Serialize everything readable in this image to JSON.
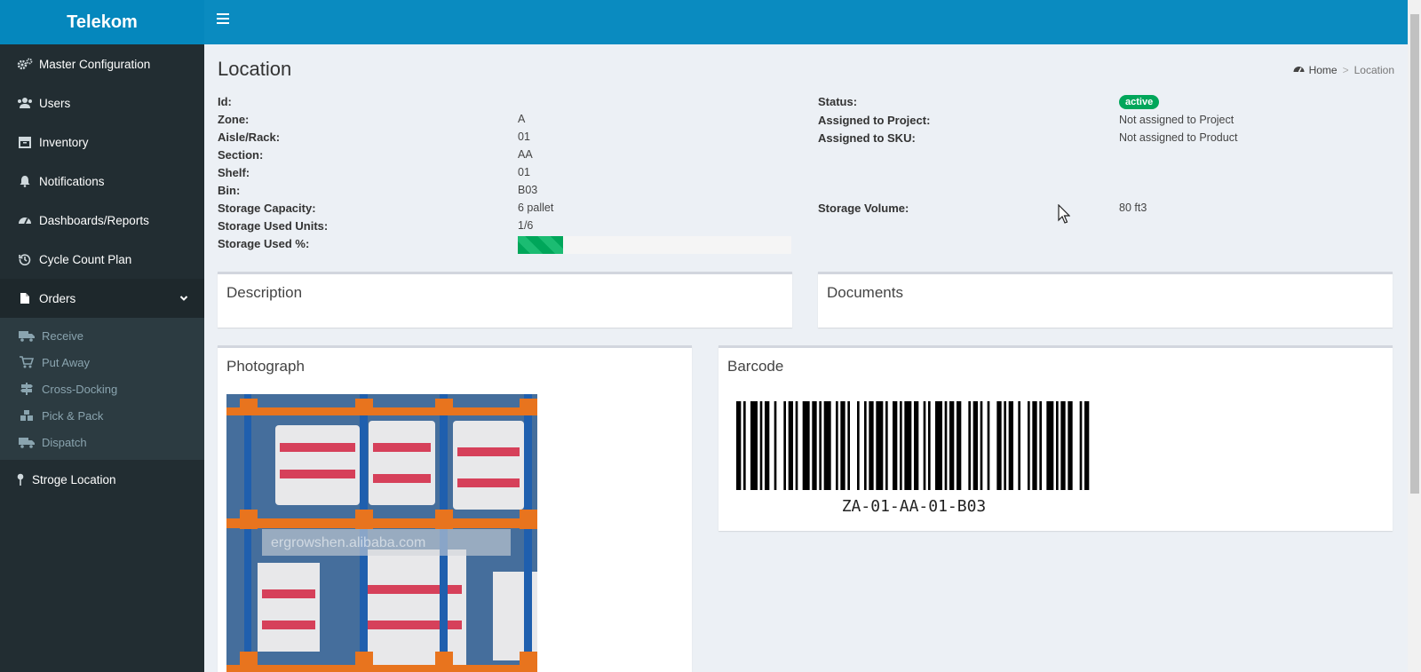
{
  "app": {
    "brand": "Telekom"
  },
  "sidebar": {
    "items": [
      {
        "label": "Master Configuration",
        "icon": "gears-icon"
      },
      {
        "label": "Users",
        "icon": "users-icon"
      },
      {
        "label": "Inventory",
        "icon": "inventory-icon"
      },
      {
        "label": "Notifications",
        "icon": "bell-icon"
      },
      {
        "label": "Dashboards/Reports",
        "icon": "dashboard-icon"
      },
      {
        "label": "Cycle Count Plan",
        "icon": "history-icon"
      },
      {
        "label": "Orders",
        "icon": "file-icon",
        "expanded": true
      },
      {
        "label": "Stroge Location",
        "icon": "map-pin-icon"
      }
    ],
    "orders_submenu": [
      {
        "label": "Receive",
        "icon": "truck-icon"
      },
      {
        "label": "Put Away",
        "icon": "cart-icon"
      },
      {
        "label": "Cross-Docking",
        "icon": "signs-icon"
      },
      {
        "label": "Pick & Pack",
        "icon": "cubes-icon"
      },
      {
        "label": "Dispatch",
        "icon": "truck-icon"
      }
    ]
  },
  "page": {
    "title": "Location",
    "breadcrumb": {
      "home": "Home",
      "current": "Location"
    }
  },
  "details": {
    "id_label": "Id:",
    "id_value": "",
    "zone_label": "Zone:",
    "zone_value": "A",
    "aisle_label": "Aisle/Rack:",
    "aisle_value": "01",
    "section_label": "Section:",
    "section_value": "AA",
    "shelf_label": "Shelf:",
    "shelf_value": "01",
    "bin_label": "Bin:",
    "bin_value": "B03",
    "capacity_label": "Storage Capacity:",
    "capacity_value": "6 pallet",
    "used_units_label": "Storage Used Units:",
    "used_units_value": "1/6",
    "used_pct_label": "Storage Used %:",
    "used_pct_value": 0.167,
    "status_label": "Status:",
    "status_value": "active",
    "project_label": "Assigned to Project:",
    "project_value": "Not assigned to Project",
    "sku_label": "Assigned to SKU:",
    "sku_value": "Not assigned to Product",
    "volume_label": "Storage Volume:",
    "volume_value": "80 ft3"
  },
  "boxes": {
    "description": "Description",
    "documents": "Documents",
    "photograph": "Photograph",
    "barcode": "Barcode",
    "barcode_text": "ZA-01-AA-01-B03"
  },
  "photo": {
    "watermark": "ergrowshen.alibaba.com"
  },
  "colors": {
    "topbar": "#0a8bc0",
    "sidebar": "#222d32",
    "status_active": "#00a65a"
  }
}
